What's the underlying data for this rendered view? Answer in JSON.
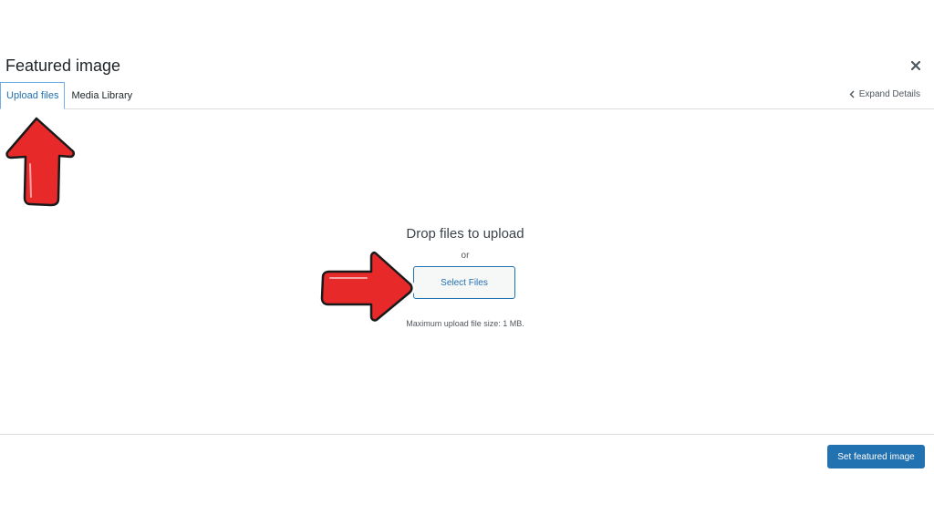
{
  "modal": {
    "title": "Featured image",
    "close_icon": "close-icon"
  },
  "tabs": [
    {
      "label": "Upload files",
      "active": true
    },
    {
      "label": "Media Library",
      "active": false
    }
  ],
  "expand_details": {
    "label": "Expand Details",
    "icon": "chevron-left-icon"
  },
  "uploader": {
    "drop_text": "Drop files to upload",
    "or_text": "or",
    "select_button": "Select Files",
    "max_size_text": "Maximum upload file size: 1 MB."
  },
  "footer": {
    "set_button": "Set featured image"
  },
  "annotations": {
    "arrow_color": "#e8292a",
    "icons": [
      "arrow-up-icon",
      "arrow-right-icon"
    ]
  },
  "colors": {
    "accent": "#2271b1",
    "divider": "#dcdcde"
  }
}
